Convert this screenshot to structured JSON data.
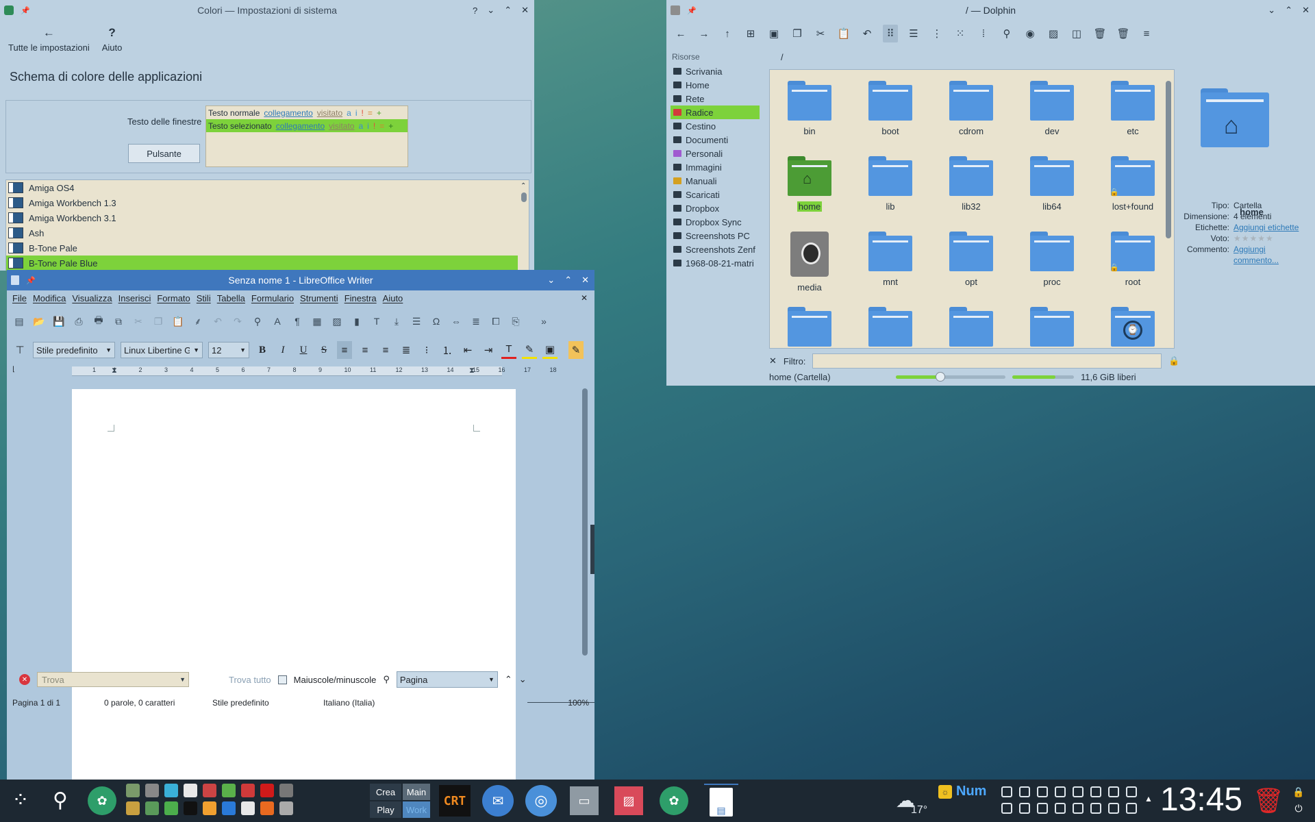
{
  "settings": {
    "title": "Colori — Impostazioni di sistema",
    "controls": [
      "?",
      "⌄",
      "⌃",
      "✕"
    ],
    "nav": [
      {
        "icon": "←",
        "label": "Tutte le impostazioni"
      },
      {
        "icon": "?",
        "label": "Aiuto"
      }
    ],
    "heading": "Schema di colore delle applicazioni",
    "preview": {
      "label": "Testo delle finestre",
      "button": "Pulsante",
      "normal_text": "Testo normale",
      "selected_text": "Testo selezionato",
      "link": "collegamento",
      "visited": "visitato",
      "symbols": [
        "a",
        "i",
        "!",
        "=",
        "+"
      ]
    },
    "schemes": [
      "Amiga OS4",
      "Amiga Workbench 1.3",
      "Amiga Workbench 3.1",
      "Ash",
      "B-Tone Pale",
      "B-Tone Pale Blue"
    ],
    "selected_scheme": "B-Tone Pale Blue"
  },
  "dolphin": {
    "title": "/ — Dolphin",
    "places_header": "Risorse",
    "places": [
      {
        "label": "Scrivania",
        "icon": "desktop-icon",
        "color": "#2b3a47"
      },
      {
        "label": "Home",
        "icon": "home-icon",
        "color": "#2b3a47"
      },
      {
        "label": "Rete",
        "icon": "network-icon",
        "color": "#2b3a47"
      },
      {
        "label": "Radice",
        "icon": "root-folder-icon",
        "color": "#d23b3b"
      },
      {
        "label": "Cestino",
        "icon": "trash-icon",
        "color": "#2b3a47"
      },
      {
        "label": "Documenti",
        "icon": "documents-icon",
        "color": "#2b3a47"
      },
      {
        "label": "Personali",
        "icon": "folder-icon",
        "color": "#a05ad0"
      },
      {
        "label": "Immagini",
        "icon": "pictures-icon",
        "color": "#2b3a47"
      },
      {
        "label": "Manuali",
        "icon": "folder-icon",
        "color": "#d4a020"
      },
      {
        "label": "Scaricati",
        "icon": "downloads-icon",
        "color": "#2b3a47"
      },
      {
        "label": "Dropbox",
        "icon": "dropbox-icon",
        "color": "#2b3a47"
      },
      {
        "label": "Dropbox Sync",
        "icon": "dropbox-icon",
        "color": "#2b3a47"
      },
      {
        "label": "Screenshots PC",
        "icon": "pictures-icon",
        "color": "#2b3a47"
      },
      {
        "label": "Screenshots Zenf",
        "icon": "folder-icon",
        "color": "#2b3a47"
      },
      {
        "label": "1968-08-21-matri",
        "icon": "folder-icon",
        "color": "#2b3a47"
      }
    ],
    "path": "/",
    "files": [
      "bin",
      "boot",
      "cdrom",
      "dev",
      "etc",
      "home",
      "lib",
      "lib32",
      "lib64",
      "lost+found",
      "media",
      "mnt",
      "opt",
      "proc",
      "root",
      "",
      "",
      "",
      "",
      ""
    ],
    "selected_file": "home",
    "info": {
      "name": "home",
      "rows": [
        {
          "key": "Tipo:",
          "value": "Cartella"
        },
        {
          "key": "Dimensione:",
          "value": "4 elementi"
        },
        {
          "key": "Etichette:",
          "value": "Aggiungi etichette"
        },
        {
          "key": "Voto:",
          "value": "★★★★★"
        },
        {
          "key": "Commento:",
          "value": "Aggiungi commento..."
        }
      ]
    },
    "filter_label": "Filtro:",
    "status_text": "home (Cartella)",
    "free_space": "11,6 GiB liberi"
  },
  "writer": {
    "title": "Senza nome 1 - LibreOffice Writer",
    "menu": [
      "File",
      "Modifica",
      "Visualizza",
      "Inserisci",
      "Formato",
      "Stili",
      "Tabella",
      "Formulario",
      "Strumenti",
      "Finestra",
      "Aiuto"
    ],
    "paragraph_style": "Stile predefinito",
    "font_name": "Linux Libertine G",
    "font_size": "12",
    "ruler_numbers": [
      "1",
      "1",
      "2",
      "3",
      "4",
      "5",
      "6",
      "7",
      "8",
      "9",
      "10",
      "11",
      "12",
      "13",
      "14",
      "15",
      "16",
      "17",
      "18"
    ],
    "find_placeholder": "Trova",
    "find_all": "Trova tutto",
    "match_case": "Maiuscole/minuscole",
    "find_scope": "Pagina",
    "status": {
      "page": "Pagina 1 di 1",
      "words": "0 parole, 0 caratteri",
      "style": "Stile predefinito",
      "language": "Italiano (Italia)",
      "zoom": "100%"
    }
  },
  "taskbar": {
    "activities": [
      "Crea",
      "Main",
      "Play",
      "Work"
    ],
    "crt_label": "CRT",
    "num_label": "Num",
    "temperature": "17°",
    "clock": "13:45"
  }
}
